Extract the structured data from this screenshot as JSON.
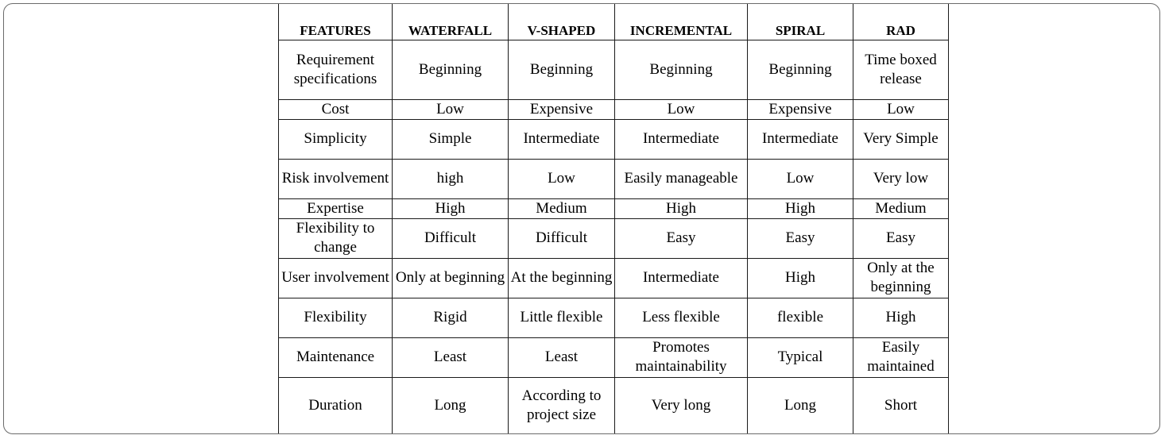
{
  "table": {
    "headers": [
      "FEATURES",
      "WATERFALL",
      "V-SHAPED",
      "INCREMENTAL",
      "SPIRAL",
      "RAD"
    ],
    "rows": [
      [
        "Requirement specifications",
        "Beginning",
        "Beginning",
        "Beginning",
        "Beginning",
        "Time boxed release"
      ],
      [
        "Cost",
        "Low",
        "Expensive",
        "Low",
        "Expensive",
        "Low"
      ],
      [
        "Simplicity",
        "Simple",
        "Intermediate",
        "Intermediate",
        "Intermediate",
        "Very Simple"
      ],
      [
        "Risk involvement",
        "high",
        "Low",
        "Easily manageable",
        "Low",
        "Very low"
      ],
      [
        "Expertise",
        "High",
        "Medium",
        "High",
        "High",
        "Medium"
      ],
      [
        "Flexibility to change",
        "Difficult",
        "Difficult",
        "Easy",
        "Easy",
        "Easy"
      ],
      [
        "User involvement",
        "Only at beginning",
        "At the beginning",
        "Intermediate",
        "High",
        "Only at the beginning"
      ],
      [
        "Flexibility",
        "Rigid",
        "Little flexible",
        "Less flexible",
        "flexible",
        "High"
      ],
      [
        "Maintenance",
        "Least",
        "Least",
        "Promotes maintainability",
        "Typical",
        "Easily maintained"
      ],
      [
        "Duration",
        "Long",
        "According to project size",
        "Very long",
        "Long",
        "Short"
      ]
    ]
  }
}
